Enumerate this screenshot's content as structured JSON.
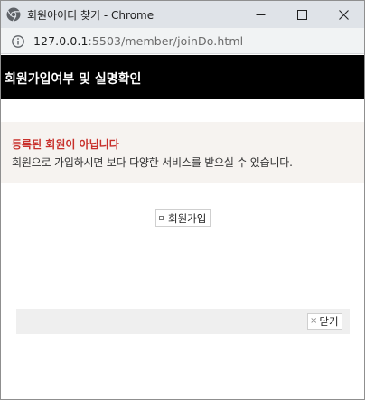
{
  "window": {
    "title": "회원아이디 찾기 - Chrome"
  },
  "address_bar": {
    "host": "127.0.0.1",
    "path": ":5503/member/joinDo.html"
  },
  "page": {
    "title": "회원가입여부 및 실명확인"
  },
  "message": {
    "title": "등록된 회원이 아닙니다",
    "description": "회원으로 가입하시면 보다 다양한 서비스를 받으실 수 있습니다."
  },
  "buttons": {
    "join_label": "회원가입",
    "close_label": "닫기"
  },
  "icons": {
    "browser_logo": "chrome-logo-icon",
    "minimize": "minimize-icon",
    "maximize": "maximize-icon",
    "close": "close-icon",
    "site_info": "info-icon",
    "join_bullet": "square-icon",
    "close_bullet": "x-icon"
  },
  "colors": {
    "header_bg": "#000000",
    "message_title": "#c8302b",
    "message_bg": "#f6f3f0",
    "bottom_bar_bg": "#efefef"
  }
}
